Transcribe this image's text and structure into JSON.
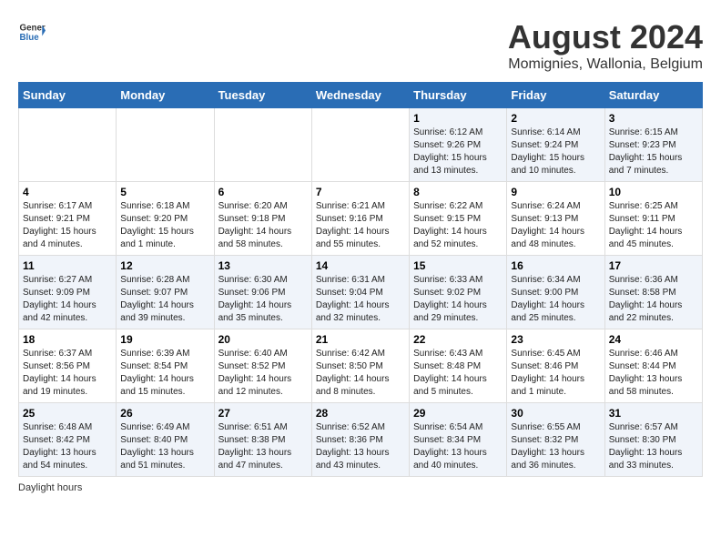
{
  "header": {
    "logo_general": "General",
    "logo_blue": "Blue",
    "title": "August 2024",
    "subtitle": "Momignies, Wallonia, Belgium"
  },
  "days_of_week": [
    "Sunday",
    "Monday",
    "Tuesday",
    "Wednesday",
    "Thursday",
    "Friday",
    "Saturday"
  ],
  "weeks": [
    [
      {
        "day": "",
        "info": ""
      },
      {
        "day": "",
        "info": ""
      },
      {
        "day": "",
        "info": ""
      },
      {
        "day": "",
        "info": ""
      },
      {
        "day": "1",
        "info": "Sunrise: 6:12 AM\nSunset: 9:26 PM\nDaylight: 15 hours and 13 minutes."
      },
      {
        "day": "2",
        "info": "Sunrise: 6:14 AM\nSunset: 9:24 PM\nDaylight: 15 hours and 10 minutes."
      },
      {
        "day": "3",
        "info": "Sunrise: 6:15 AM\nSunset: 9:23 PM\nDaylight: 15 hours and 7 minutes."
      }
    ],
    [
      {
        "day": "4",
        "info": "Sunrise: 6:17 AM\nSunset: 9:21 PM\nDaylight: 15 hours and 4 minutes."
      },
      {
        "day": "5",
        "info": "Sunrise: 6:18 AM\nSunset: 9:20 PM\nDaylight: 15 hours and 1 minute."
      },
      {
        "day": "6",
        "info": "Sunrise: 6:20 AM\nSunset: 9:18 PM\nDaylight: 14 hours and 58 minutes."
      },
      {
        "day": "7",
        "info": "Sunrise: 6:21 AM\nSunset: 9:16 PM\nDaylight: 14 hours and 55 minutes."
      },
      {
        "day": "8",
        "info": "Sunrise: 6:22 AM\nSunset: 9:15 PM\nDaylight: 14 hours and 52 minutes."
      },
      {
        "day": "9",
        "info": "Sunrise: 6:24 AM\nSunset: 9:13 PM\nDaylight: 14 hours and 48 minutes."
      },
      {
        "day": "10",
        "info": "Sunrise: 6:25 AM\nSunset: 9:11 PM\nDaylight: 14 hours and 45 minutes."
      }
    ],
    [
      {
        "day": "11",
        "info": "Sunrise: 6:27 AM\nSunset: 9:09 PM\nDaylight: 14 hours and 42 minutes."
      },
      {
        "day": "12",
        "info": "Sunrise: 6:28 AM\nSunset: 9:07 PM\nDaylight: 14 hours and 39 minutes."
      },
      {
        "day": "13",
        "info": "Sunrise: 6:30 AM\nSunset: 9:06 PM\nDaylight: 14 hours and 35 minutes."
      },
      {
        "day": "14",
        "info": "Sunrise: 6:31 AM\nSunset: 9:04 PM\nDaylight: 14 hours and 32 minutes."
      },
      {
        "day": "15",
        "info": "Sunrise: 6:33 AM\nSunset: 9:02 PM\nDaylight: 14 hours and 29 minutes."
      },
      {
        "day": "16",
        "info": "Sunrise: 6:34 AM\nSunset: 9:00 PM\nDaylight: 14 hours and 25 minutes."
      },
      {
        "day": "17",
        "info": "Sunrise: 6:36 AM\nSunset: 8:58 PM\nDaylight: 14 hours and 22 minutes."
      }
    ],
    [
      {
        "day": "18",
        "info": "Sunrise: 6:37 AM\nSunset: 8:56 PM\nDaylight: 14 hours and 19 minutes."
      },
      {
        "day": "19",
        "info": "Sunrise: 6:39 AM\nSunset: 8:54 PM\nDaylight: 14 hours and 15 minutes."
      },
      {
        "day": "20",
        "info": "Sunrise: 6:40 AM\nSunset: 8:52 PM\nDaylight: 14 hours and 12 minutes."
      },
      {
        "day": "21",
        "info": "Sunrise: 6:42 AM\nSunset: 8:50 PM\nDaylight: 14 hours and 8 minutes."
      },
      {
        "day": "22",
        "info": "Sunrise: 6:43 AM\nSunset: 8:48 PM\nDaylight: 14 hours and 5 minutes."
      },
      {
        "day": "23",
        "info": "Sunrise: 6:45 AM\nSunset: 8:46 PM\nDaylight: 14 hours and 1 minute."
      },
      {
        "day": "24",
        "info": "Sunrise: 6:46 AM\nSunset: 8:44 PM\nDaylight: 13 hours and 58 minutes."
      }
    ],
    [
      {
        "day": "25",
        "info": "Sunrise: 6:48 AM\nSunset: 8:42 PM\nDaylight: 13 hours and 54 minutes."
      },
      {
        "day": "26",
        "info": "Sunrise: 6:49 AM\nSunset: 8:40 PM\nDaylight: 13 hours and 51 minutes."
      },
      {
        "day": "27",
        "info": "Sunrise: 6:51 AM\nSunset: 8:38 PM\nDaylight: 13 hours and 47 minutes."
      },
      {
        "day": "28",
        "info": "Sunrise: 6:52 AM\nSunset: 8:36 PM\nDaylight: 13 hours and 43 minutes."
      },
      {
        "day": "29",
        "info": "Sunrise: 6:54 AM\nSunset: 8:34 PM\nDaylight: 13 hours and 40 minutes."
      },
      {
        "day": "30",
        "info": "Sunrise: 6:55 AM\nSunset: 8:32 PM\nDaylight: 13 hours and 36 minutes."
      },
      {
        "day": "31",
        "info": "Sunrise: 6:57 AM\nSunset: 8:30 PM\nDaylight: 13 hours and 33 minutes."
      }
    ]
  ],
  "footer": {
    "note": "Daylight hours"
  }
}
